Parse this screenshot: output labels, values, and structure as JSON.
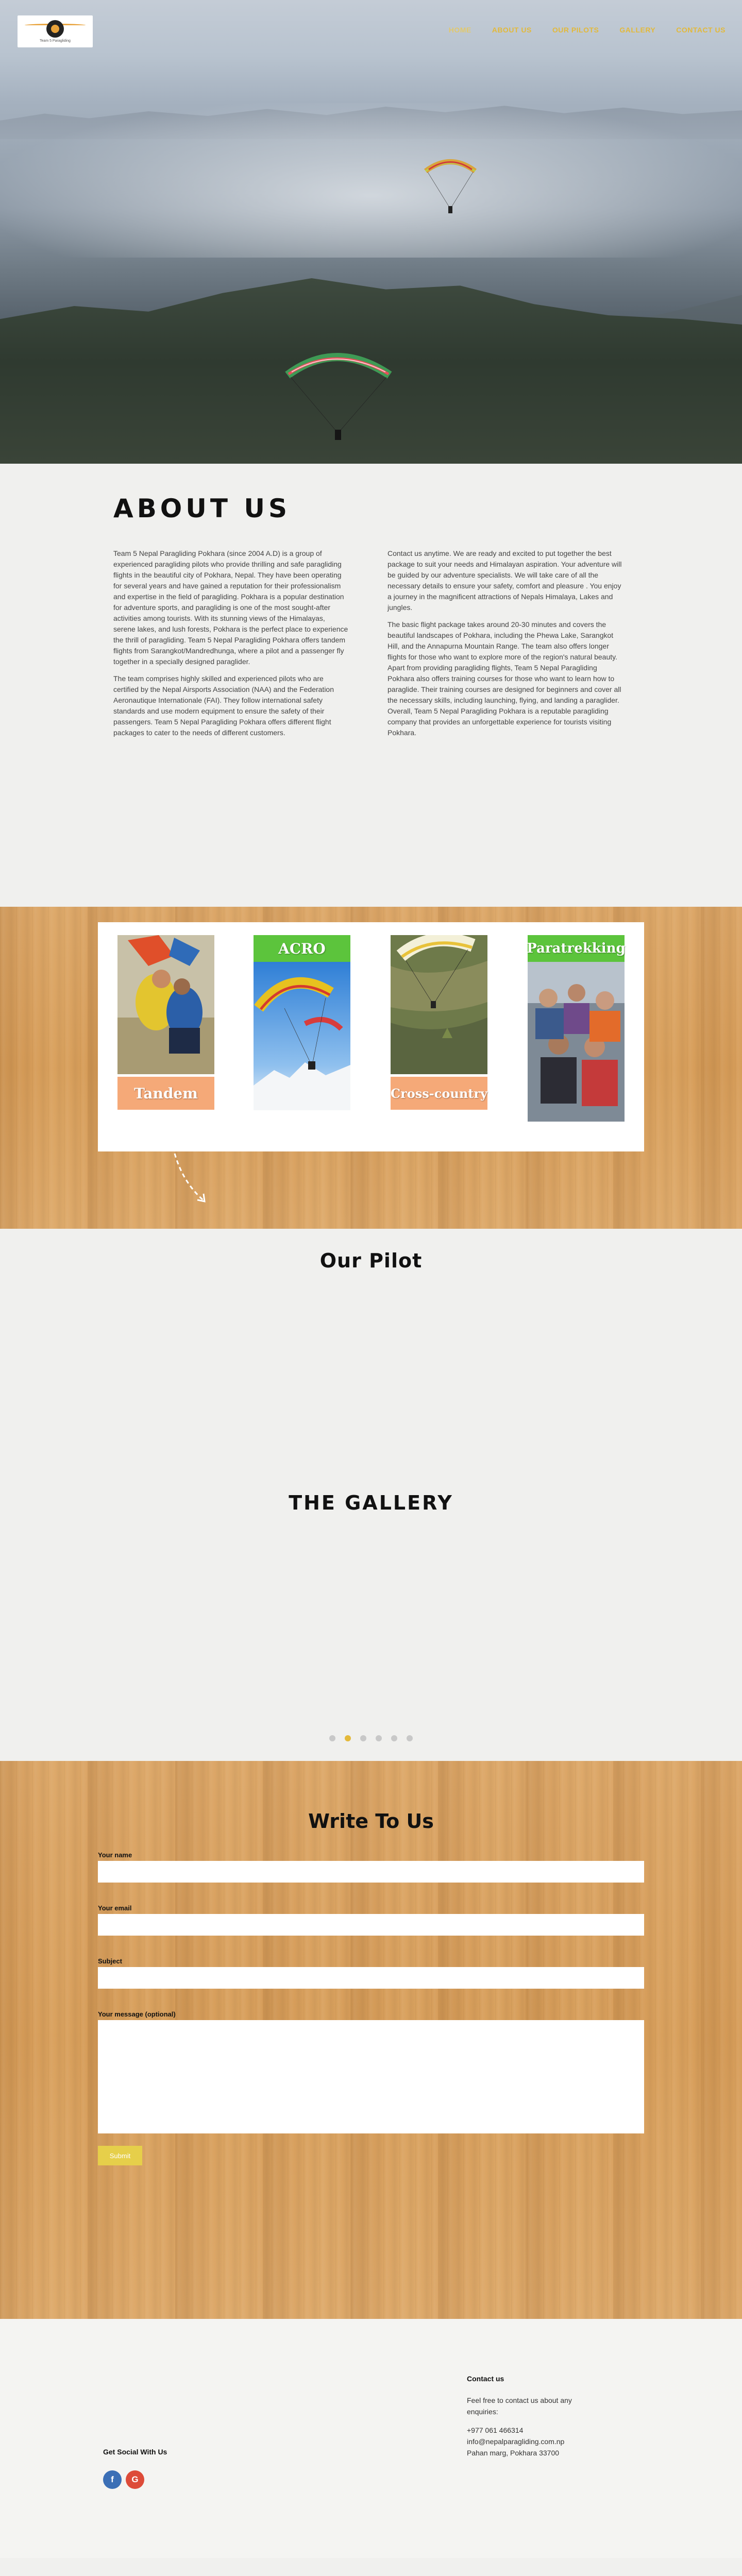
{
  "brand": {
    "logo_text": "Team 5 Paragliding"
  },
  "nav": {
    "items": [
      {
        "label": "HOME"
      },
      {
        "label": "ABOUT US"
      },
      {
        "label": "OUR PILOTS"
      },
      {
        "label": "GALLERY"
      },
      {
        "label": "CONTACT US"
      }
    ]
  },
  "about": {
    "title": "ABOUT US",
    "left": [
      "Team 5 Nepal Paragliding Pokhara (since 2004 A.D) is a group of experienced paragliding pilots who provide thrilling and safe paragliding flights in the beautiful city of Pokhara, Nepal. They have been operating for several years and have gained a reputation for their professionalism and expertise in the field of paragliding. Pokhara is a popular destination for adventure sports, and paragliding is one of the most sought-after activities among tourists. With its stunning views of the Himalayas, serene lakes, and lush forests, Pokhara is the perfect place to experience the thrill of paragliding. Team 5 Nepal Paragliding Pokhara offers tandem flights from Sarangkot/Mandredhunga, where a pilot and a passenger fly together in a specially designed paraglider.",
      "The team comprises highly skilled and experienced pilots who are certified by the Nepal Airsports Association (NAA) and the Federation Aeronautique Internationale (FAI). They follow international safety standards and use modern equipment to ensure the safety of their passengers. Team 5 Nepal Paragliding Pokhara offers different flight packages to cater to the needs of different customers."
    ],
    "right": [
      "Contact us anytime. We are ready and excited to put together the best package to suit your needs and Himalayan aspiration. Your adventure will be guided by our adventure specialists. We will take care of all the necessary details to ensure your safety, comfort and pleasure . You enjoy a journey in the magnificent attractions of Nepals Himalaya, Lakes and jungles.",
      "The basic flight package takes around 20-30 minutes and covers the beautiful landscapes of Pokhara, including the Phewa Lake, Sarangkot Hill, and the Annapurna Mountain Range. The team also offers longer flights for those who want to explore more of the region's natural beauty. Apart from providing paragliding flights, Team 5 Nepal Paragliding Pokhara also offers training courses for those who want to learn how to paraglide. Their training courses are designed for beginners and cover all the necessary skills, including launching, flying, and landing a paraglider. Overall, Team 5 Nepal Paragliding Pokhara is a reputable paragliding company that provides an unforgettable experience for tourists visiting Pokhara."
    ]
  },
  "services": [
    {
      "label": "Tandem",
      "label_color": "#f5a978"
    },
    {
      "label": "ACRO",
      "label_color": "#5cc43c"
    },
    {
      "label": "Cross-country",
      "label_color": "#f5a978"
    },
    {
      "label": "Paratrekking",
      "label_color": "#5cc43c"
    }
  ],
  "pilot": {
    "title": "Our Pilot"
  },
  "gallery": {
    "title": "THE GALLERY",
    "active_dot": 1,
    "dot_count": 6
  },
  "form": {
    "title": "Write To Us",
    "name_label": "Your name",
    "email_label": "Your email",
    "subject_label": "Subject",
    "message_label": "Your message (optional)",
    "submit_label": "Submit"
  },
  "footer": {
    "contact_title": "Contact us",
    "contact_text": "Feel free to contact us about any enquiries:",
    "phone": "+977 061 466314",
    "email": "info@nepalparagliding.com.np",
    "address": "Pahan marg, Pokhara 33700",
    "social_title": "Get Social With Us",
    "social_icons": [
      "facebook-icon",
      "google-plus-icon"
    ]
  },
  "colors": {
    "accent": "#e4b93a",
    "green": "#5cc43c",
    "peach": "#f5a978"
  }
}
